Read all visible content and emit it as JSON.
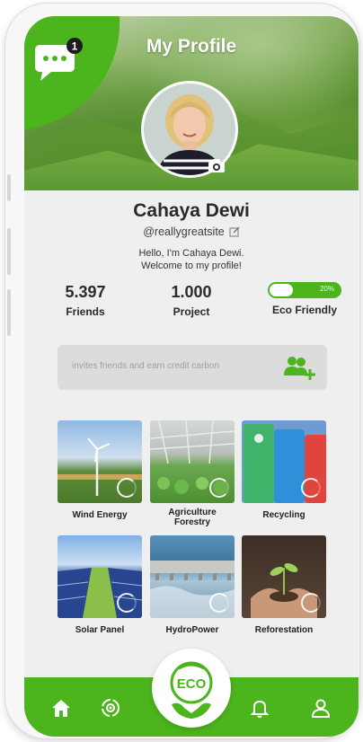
{
  "header": {
    "title": "My Profile",
    "notification_count": "1",
    "chat_icon": "chat-bubble-icon",
    "camera_icon": "camera-icon"
  },
  "profile": {
    "name": "Cahaya Dewi",
    "handle": "@reallygreatsite",
    "bio_line1": "Hello, I'm Cahaya Dewi.",
    "bio_line2": "Welcome to my profile!"
  },
  "stats": {
    "friends_value": "5.397",
    "friends_label": "Friends",
    "project_value": "1.000",
    "project_label": "Project",
    "eco_label": "Eco Friendly",
    "eco_percent_text": "20%",
    "eco_percent": 20
  },
  "invite": {
    "placeholder": "invites friends  and earn credit carbon",
    "icon": "add-user-icon"
  },
  "categories": [
    {
      "label": "Wind Energy"
    },
    {
      "label": "Agriculture Forestry"
    },
    {
      "label": "Recycling"
    },
    {
      "label": "Solar Panel"
    },
    {
      "label": "HydroPower"
    },
    {
      "label": "Reforestation"
    }
  ],
  "nav": {
    "center_badge": "ECO",
    "items": [
      "home-icon",
      "recycle-icon",
      "bell-icon",
      "user-icon"
    ]
  },
  "colors": {
    "accent": "#4cb41c",
    "background": "#efefef",
    "text": "#2a2a2a"
  }
}
